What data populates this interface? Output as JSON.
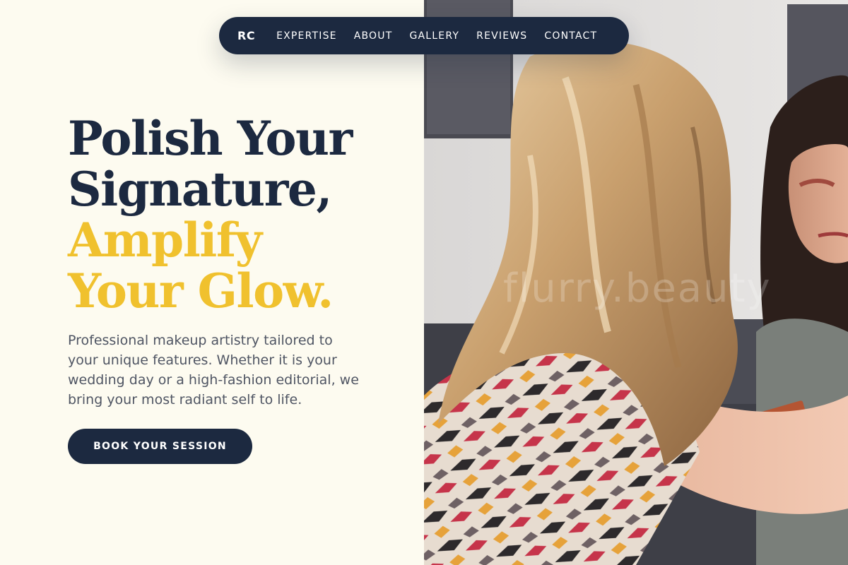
{
  "nav": {
    "logo": "RC",
    "links": [
      "EXPERTISE",
      "ABOUT",
      "GALLERY",
      "REVIEWS",
      "CONTACT"
    ]
  },
  "hero": {
    "headline_dark": [
      "Polish Your",
      "Signature,"
    ],
    "headline_accent": [
      "Amplify",
      "Your Glow."
    ],
    "description": "Professional makeup artistry tailored to your unique features. Whether it is your wedding day or a high-fashion editorial, we bring your most radiant self to life.",
    "cta_label": "BOOK YOUR SESSION"
  },
  "photo": {
    "watermark": "flurry.beauty"
  },
  "colors": {
    "navy": "#1c2940",
    "gold": "#f0c12e",
    "cream": "#fdfbf0",
    "body_text": "#4f5563"
  }
}
